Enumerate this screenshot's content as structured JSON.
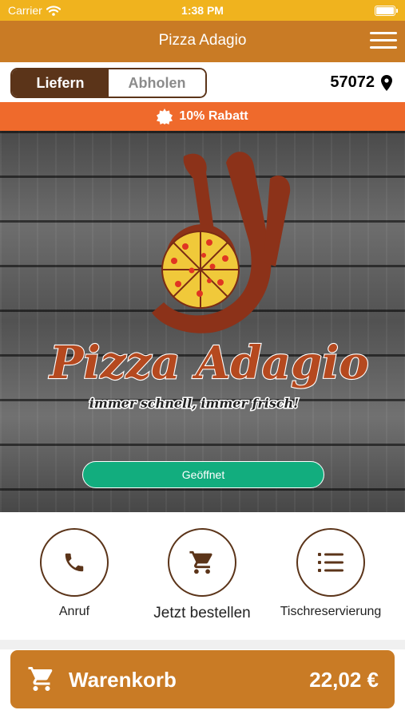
{
  "status_bar": {
    "carrier": "Carrier",
    "time": "1:38 PM"
  },
  "header": {
    "title": "Pizza Adagio",
    "menu_icon": "hamburger-menu-icon"
  },
  "mode": {
    "deliver_label": "Liefern",
    "pickup_label": "Abholen",
    "active": "deliver"
  },
  "location": {
    "postal_code": "57072",
    "icon": "map-pin-icon"
  },
  "discount": {
    "text": "10% Rabatt",
    "icon": "badge-icon"
  },
  "hero": {
    "logo_title": "Pizza Adagio",
    "logo_slogan": "immer schnell, immer frisch!",
    "status_text": "Geöffnet"
  },
  "actions": [
    {
      "label": "Anruf",
      "icon": "phone-icon"
    },
    {
      "label": "Jetzt bestellen",
      "icon": "cart-icon"
    },
    {
      "label": "Tischreservierung",
      "icon": "list-icon"
    }
  ],
  "cart": {
    "label": "Warenkorb",
    "total": "22,02 €",
    "icon": "cart-icon"
  },
  "colors": {
    "status_bar": "#f0b31e",
    "header": "#c97b25",
    "dark_brown": "#5b3419",
    "discount": "#ef6a2c",
    "open_green": "#12ad7e"
  }
}
